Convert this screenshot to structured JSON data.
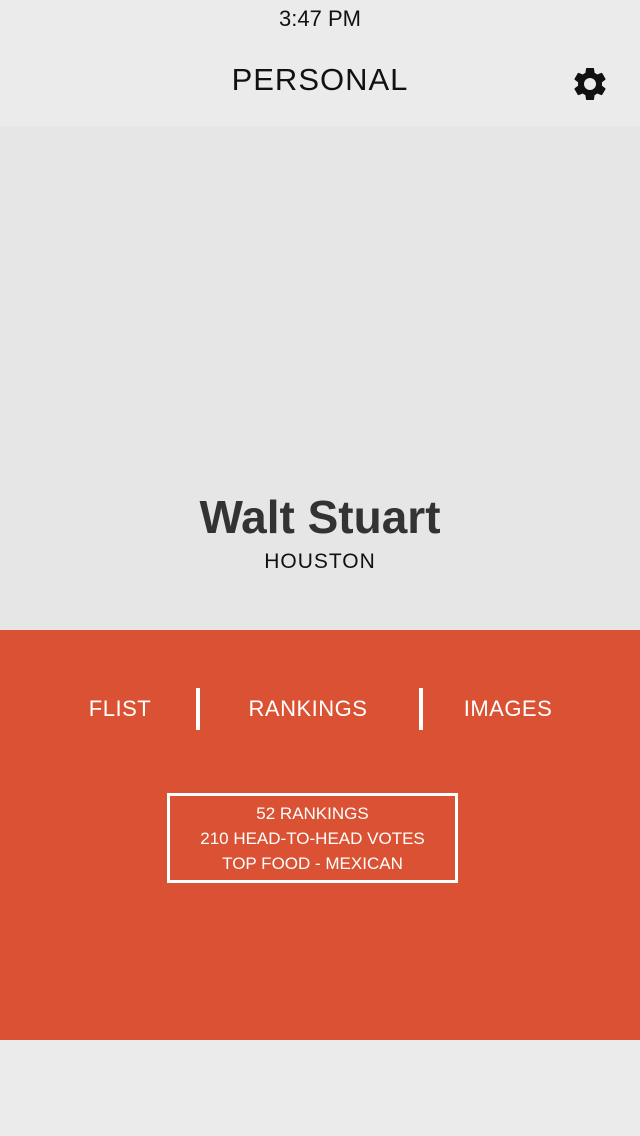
{
  "status_bar": {
    "time": "3:47 PM"
  },
  "nav": {
    "title": "PERSONAL",
    "settings_icon": "gear-icon"
  },
  "profile": {
    "name": "Walt Stuart",
    "city": "HOUSTON"
  },
  "tabs": [
    {
      "label": "FLIST"
    },
    {
      "label": "RANKINGS"
    },
    {
      "label": "IMAGES"
    }
  ],
  "stats": [
    "52 RANKINGS",
    "210 HEAD-TO-HEAD VOTES",
    "TOP FOOD - MEXICAN"
  ],
  "colors": {
    "accent": "#da5233",
    "background": "#ebebeb",
    "hero": "#e6e6e6"
  }
}
